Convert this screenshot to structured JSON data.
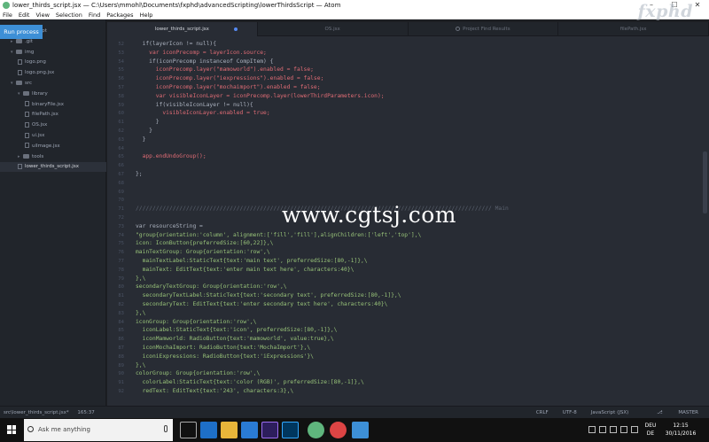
{
  "window": {
    "title": "lower_thirds_script.jsx — C:\\Users\\mmohl\\Documents\\fxphd\\advancedScripting\\lowerThirdsScript — Atom",
    "watermark_logo": "fxphd",
    "watermark_center": "www.cgtsj.com"
  },
  "menu": [
    "File",
    "Edit",
    "View",
    "Selection",
    "Find",
    "Packages",
    "Help"
  ],
  "run_button": "Run process",
  "tree": [
    {
      "label": "ThirdsScript",
      "type": "folder",
      "depth": 0,
      "open": true
    },
    {
      "label": ".git",
      "type": "folder",
      "depth": 1,
      "open": false
    },
    {
      "label": "img",
      "type": "folder",
      "depth": 1,
      "open": true
    },
    {
      "label": "logo.png",
      "type": "file",
      "depth": 2
    },
    {
      "label": "logo.png.jsx",
      "type": "file",
      "depth": 2
    },
    {
      "label": "src",
      "type": "folder",
      "depth": 1,
      "open": true
    },
    {
      "label": "library",
      "type": "folder",
      "depth": 2,
      "open": true
    },
    {
      "label": "binaryFile.jsx",
      "type": "file",
      "depth": 3
    },
    {
      "label": "filePath.jsx",
      "type": "file",
      "depth": 3
    },
    {
      "label": "OS.jsx",
      "type": "file",
      "depth": 3
    },
    {
      "label": "ui.jsx",
      "type": "file",
      "depth": 3
    },
    {
      "label": "uiImage.jsx",
      "type": "file",
      "depth": 3
    },
    {
      "label": "tools",
      "type": "folder",
      "depth": 2,
      "open": false
    },
    {
      "label": "lower_thirds_script.jsx",
      "type": "file",
      "depth": 2,
      "selected": true
    }
  ],
  "tabs": [
    {
      "label": "lower_thirds_script.jsx",
      "active": true,
      "modified": true
    },
    {
      "label": "OS.jsx",
      "active": false
    },
    {
      "label": "Project Find Results",
      "active": false,
      "icon": "search-icon"
    },
    {
      "label": "filePath.jsx",
      "active": false
    }
  ],
  "code_lines": [
    {
      "n": "52",
      "text": "  if(layerIcon != null){",
      "cls": ""
    },
    {
      "n": "53",
      "text": "    var iconPrecomp = layerIcon.source;",
      "cls": "var"
    },
    {
      "n": "54",
      "text": "    if(iconPrecomp instanceof CompItem) {",
      "cls": ""
    },
    {
      "n": "55",
      "text": "      iconPrecomp.layer(\"mamoworld\").enabled = false;",
      "cls": "var"
    },
    {
      "n": "56",
      "text": "      iconPrecomp.layer(\"iexpressions\").enabled = false;",
      "cls": "var"
    },
    {
      "n": "57",
      "text": "      iconPrecomp.layer(\"mochaimport\").enabled = false;",
      "cls": "var"
    },
    {
      "n": "58",
      "text": "      var visibleIconLayer = iconPrecomp.layer(lowerThirdParameters.icon);",
      "cls": "var"
    },
    {
      "n": "59",
      "text": "      if(visibleIconLayer != null){",
      "cls": ""
    },
    {
      "n": "60",
      "text": "        visibleIconLayer.enabled = true;",
      "cls": "var"
    },
    {
      "n": "61",
      "text": "      }",
      "cls": ""
    },
    {
      "n": "62",
      "text": "    }",
      "cls": ""
    },
    {
      "n": "63",
      "text": "  }",
      "cls": ""
    },
    {
      "n": "64",
      "text": "",
      "cls": ""
    },
    {
      "n": "65",
      "text": "  app.endUndoGroup();",
      "cls": "var"
    },
    {
      "n": "66",
      "text": "",
      "cls": ""
    },
    {
      "n": "67",
      "text": "};",
      "cls": ""
    },
    {
      "n": "68",
      "text": "",
      "cls": ""
    },
    {
      "n": "69",
      "text": "",
      "cls": ""
    },
    {
      "n": "70",
      "text": "",
      "cls": ""
    },
    {
      "n": "71",
      "text": "////////////////////////////////////////////////////////////////////////////////////////////////////////// Main",
      "cls": "cmt"
    },
    {
      "n": "72",
      "text": "",
      "cls": ""
    },
    {
      "n": "73",
      "text": "var resourceString =",
      "cls": ""
    },
    {
      "n": "74",
      "text": "\"group{orientation:'column', alignment:['fill','fill'],alignChildren:['left','top'],\\",
      "cls": "str"
    },
    {
      "n": "75",
      "text": "icon: IconButton{preferredSize:[60,22]},\\",
      "cls": "str"
    },
    {
      "n": "76",
      "text": "mainTextGroup: Group{orientation:'row',\\",
      "cls": "str"
    },
    {
      "n": "77",
      "text": "  mainTextLabel:StaticText{text:'main text', preferredSize:[80,-1]},\\",
      "cls": "str"
    },
    {
      "n": "78",
      "text": "  mainText: EditText{text:'enter main text here', characters:40}\\",
      "cls": "str"
    },
    {
      "n": "79",
      "text": "},\\",
      "cls": "str"
    },
    {
      "n": "80",
      "text": "secondaryTextGroup: Group{orientation:'row',\\",
      "cls": "str"
    },
    {
      "n": "81",
      "text": "  secondaryTextLabel:StaticText{text:'secondary text', preferredSize:[80,-1]},\\",
      "cls": "str"
    },
    {
      "n": "82",
      "text": "  secondaryText: EditText{text:'enter secondary text here', characters:40}\\",
      "cls": "str"
    },
    {
      "n": "83",
      "text": "},\\",
      "cls": "str"
    },
    {
      "n": "84",
      "text": "iconGroup: Group{orientation:'row',\\",
      "cls": "str"
    },
    {
      "n": "85",
      "text": "  iconLabel:StaticText{text:'icon', preferredSize:[80,-1]},\\",
      "cls": "str"
    },
    {
      "n": "86",
      "text": "  iconMamworld: RadioButton{text:'mamoworld', value:true},\\",
      "cls": "str"
    },
    {
      "n": "87",
      "text": "  iconMochaImport: RadioButton{text:'MochaImport'},\\",
      "cls": "str"
    },
    {
      "n": "88",
      "text": "  iconiExpressions: RadioButton{text:'iExpressions'}\\",
      "cls": "str"
    },
    {
      "n": "89",
      "text": "},\\",
      "cls": "str"
    },
    {
      "n": "90",
      "text": "colorGroup: Group{orientation:'row',\\",
      "cls": "str"
    },
    {
      "n": "91",
      "text": "  colorLabel:StaticText{text:'color (RGB)', preferredSize:[80,-1]},\\",
      "cls": "str"
    },
    {
      "n": "92",
      "text": "  redText: EditText{text:'243', characters:3},\\",
      "cls": "str"
    }
  ],
  "status": {
    "path": "src\\lower_thirds_script.jsx*",
    "cursor": "165:37",
    "line_ending": "CRLF",
    "encoding": "UTF-8",
    "grammar": "JavaScript (JSX)",
    "branch": "MASTER"
  },
  "taskbar": {
    "search_placeholder": "Ask me anything",
    "lang_top": "DEU",
    "lang_bottom": "DE",
    "time": "12:15",
    "date": "30/11/2016"
  },
  "colors": {
    "accent": "#3d8fd6",
    "editor_bg": "#282c34",
    "sidebar_bg": "#21252b"
  }
}
